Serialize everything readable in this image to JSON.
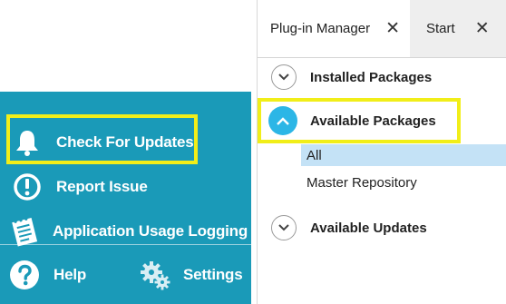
{
  "menu": {
    "items": [
      {
        "label": "Check For Updates",
        "icon": "bell-icon"
      },
      {
        "label": "Report Issue",
        "icon": "exclamation-circle-icon"
      },
      {
        "label": "Application Usage Logging",
        "icon": "notepad-icon"
      },
      {
        "label": "Help",
        "icon": "question-circle-icon"
      },
      {
        "label": "Settings",
        "icon": "gears-icon"
      }
    ],
    "background_color": "#1a9ab8",
    "highlight_color": "#f1ee19"
  },
  "plugin_manager": {
    "tabs": [
      {
        "label": "Plug-in Manager",
        "close": "✕"
      },
      {
        "label": "Start",
        "close": "✕"
      }
    ],
    "sections": [
      {
        "label": "Installed Packages",
        "expanded": false
      },
      {
        "label": "Available Packages",
        "expanded": true
      },
      {
        "label": "Available Updates",
        "expanded": false
      }
    ],
    "available_packages_items": [
      {
        "label": "All",
        "selected": true
      },
      {
        "label": "Master Repository",
        "selected": false
      }
    ],
    "accent_color": "#2cb6e6",
    "selection_color": "#c4e2f6"
  }
}
